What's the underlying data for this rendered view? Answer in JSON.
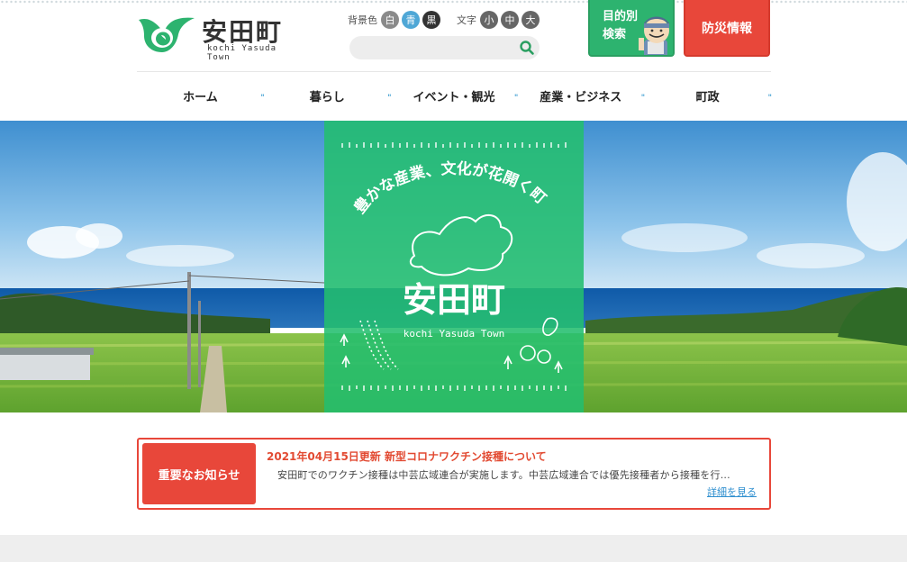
{
  "header": {
    "logo_title": "安田町",
    "logo_subtitle": "kochi Yasuda Town",
    "bg_color_label": "背景色",
    "bg_color_options": [
      "白",
      "青",
      "黒"
    ],
    "font_size_label": "文字",
    "font_size_options": [
      "小",
      "中",
      "大"
    ],
    "search_placeholder": "",
    "purpose_button": "目的別 検索",
    "disaster_button": "防災情報"
  },
  "nav": {
    "items": [
      "ホーム",
      "暮らし",
      "イベント・観光",
      "産業・ビジネス",
      "町政"
    ]
  },
  "hero": {
    "catchphrase": "豊かな産業、文化が花開く町",
    "town_name": "安田町",
    "town_name_en": "kochi Yasuda Town"
  },
  "notice": {
    "label": "重要なお知らせ",
    "headline": "2021年04月15日更新 新型コロナワクチン接種について",
    "body": "安田町でのワクチン接種は中芸広域連合が実施します。中芸広域連合では優先接種者から接種を行...",
    "more_link": "詳細を見る"
  },
  "colors": {
    "brand_green": "#2db36f",
    "alert_red": "#e8473a",
    "accent_blue": "#4fa7d6"
  }
}
